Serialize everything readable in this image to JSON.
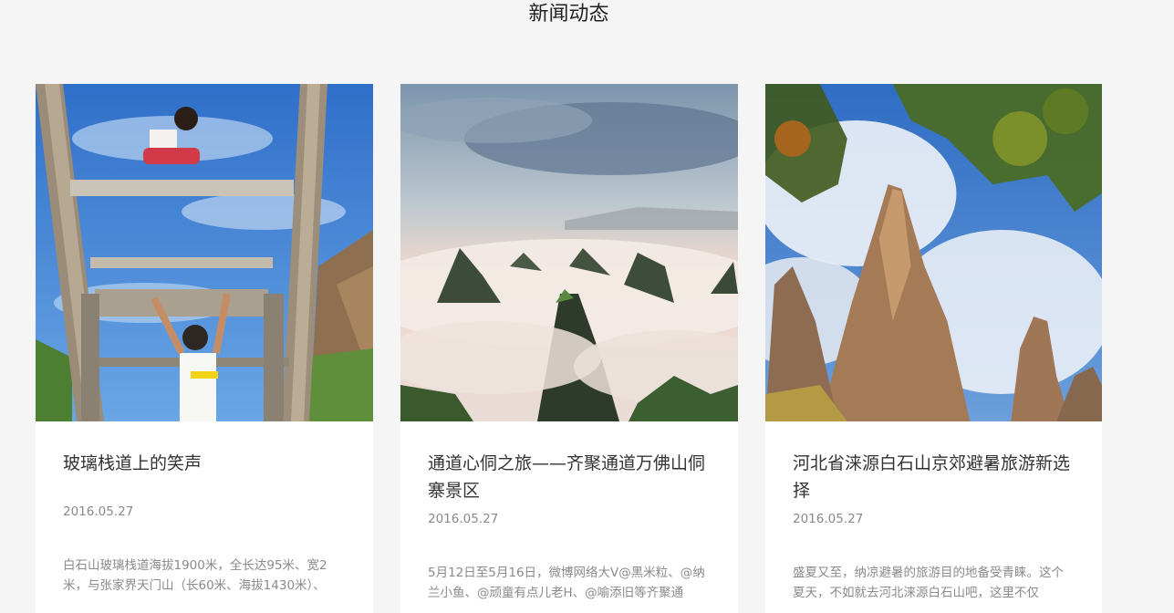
{
  "section": {
    "title": "新闻动态"
  },
  "cards": [
    {
      "title": "玻璃栈道上的笑声",
      "date": "2016.05.27",
      "excerpt": "白石山玻璃栈道海拔1900米，全长达95米、宽2米，与张家界天门山（长60米、海拔1430米）、"
    },
    {
      "title": "通道心侗之旅——齐聚通道万佛山侗 寨景区",
      "date": "2016.05.27",
      "excerpt": "5月12日至5月16日，微博网络大V@黑米粒、@纳兰小鱼、@顽童有点儿老H、@喻添旧等齐聚通"
    },
    {
      "title": "河北省涞源白石山京郊避暑旅游新选择",
      "date": "2016.05.27",
      "excerpt": "盛夏又至，纳凉避暑的旅游目的地备受青睐。这个夏天，不如就去河北涞源白石山吧，这里不仅"
    }
  ],
  "colors": {
    "background": "#f5f5f5",
    "card": "#ffffff",
    "title_text": "#333333",
    "meta_text": "#8a8a8a"
  }
}
